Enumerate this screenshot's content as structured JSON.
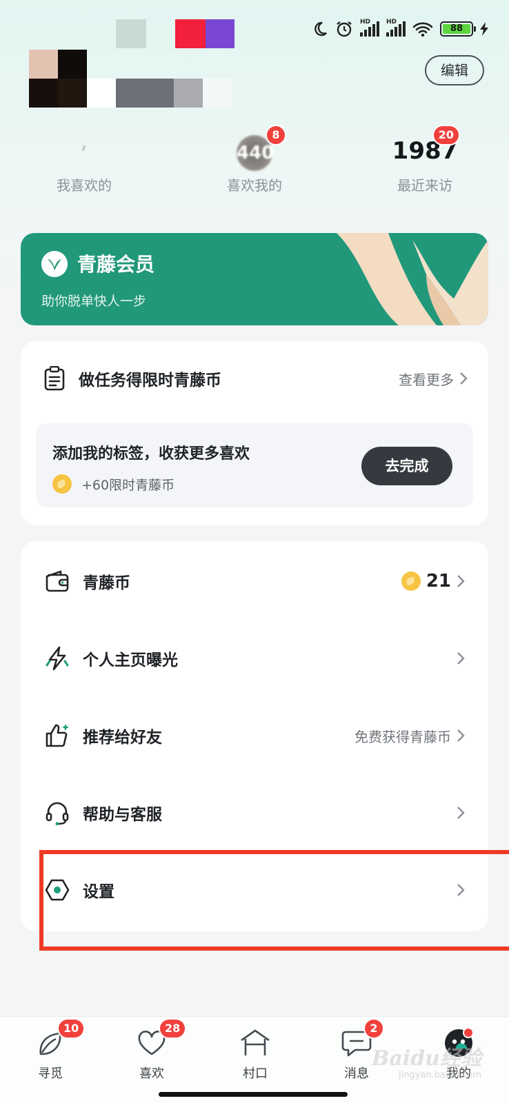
{
  "status_bar": {
    "battery_level": "88",
    "signal_1_label": "HD",
    "signal_2_label": "HD",
    "icons": [
      "moon-icon",
      "alarm-icon",
      "signal-icon",
      "signal-icon",
      "wifi-icon",
      "battery-icon",
      "charging-icon"
    ]
  },
  "header": {
    "edit_label": "编辑"
  },
  "stats": [
    {
      "value": "",
      "label": "我喜欢的",
      "badge": ""
    },
    {
      "value": "440",
      "label": "喜欢我的",
      "badge": "8"
    },
    {
      "value": "1987",
      "label": "最近来访",
      "badge": "20"
    }
  ],
  "vip": {
    "title": "青藤会员",
    "subtitle": "助你脱单快人一步",
    "accent": "#21987a"
  },
  "task": {
    "title": "做任务得限时青藤币",
    "more_label": "查看更多",
    "item_title": "添加我的标签，收获更多喜欢",
    "item_reward": "+60限时青藤币",
    "item_button": "去完成"
  },
  "menu": [
    {
      "label": "青藤币",
      "right_text": "",
      "right_value": "21",
      "icon": "wallet-icon"
    },
    {
      "label": "个人主页曝光",
      "right_text": "",
      "right_value": "",
      "icon": "lightning-icon"
    },
    {
      "label": "推荐给好友",
      "right_text": "免费获得青藤币",
      "right_value": "",
      "icon": "thumbs-up-icon"
    },
    {
      "label": "帮助与客服",
      "right_text": "",
      "right_value": "",
      "icon": "headset-icon"
    },
    {
      "label": "设置",
      "right_text": "",
      "right_value": "",
      "icon": "settings-icon"
    }
  ],
  "bottom_nav": [
    {
      "label": "寻觅",
      "badge": "10",
      "icon": "leaf-icon"
    },
    {
      "label": "喜欢",
      "badge": "28",
      "icon": "heart-icon"
    },
    {
      "label": "村口",
      "badge": "",
      "icon": "house-icon"
    },
    {
      "label": "消息",
      "badge": "2",
      "icon": "chat-icon"
    },
    {
      "label": "我的",
      "badge": "",
      "icon": "profile-face-icon"
    }
  ],
  "watermark": {
    "text": "Baidu经验",
    "url_text": "jingyan.baidu.com"
  }
}
